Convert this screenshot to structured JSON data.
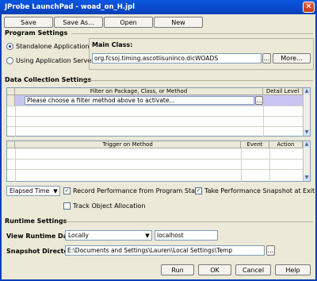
{
  "window": {
    "title": "JProbe LaunchPad - woad_on_H.jpl",
    "close_glyph": "✕"
  },
  "toolbar": {
    "save": "Save",
    "save_as": "Save As...",
    "open": "Open",
    "new": "New"
  },
  "program_settings": {
    "label": "Program Settings",
    "standalone_label": "Standalone Application",
    "server_label": "Using Application Server",
    "main_class_label": "Main Class:",
    "main_class_value": "org.fcsoj.timing.ascotlisuninco.dicWOADS",
    "browse": "...",
    "more": "More..."
  },
  "data_collection": {
    "label": "Data Collection Settings",
    "filter_table": {
      "col_filter": "Filter on Package, Class, or Method",
      "col_detail": "Detail Level",
      "row_value": "Please choose a filter method above to activate..."
    },
    "trigger_table": {
      "col_trigger": "Trigger on Method",
      "col_event": "Event",
      "col_action": "Action"
    },
    "elapsed_combo": "Elapsed Time",
    "record_perf_label": "Record Performance from Program Start",
    "snapshot_label": "Take Performance Snapshot at Exit",
    "track_alloc_label": "Track Object Allocation"
  },
  "runtime": {
    "label": "Runtime Settings",
    "view_label": "View Runtime Data:",
    "view_value": "Locally",
    "host_value": "localhost",
    "snapshot_dir_label": "Snapshot Directory:",
    "snapshot_dir_value": "E:\\Documents and Settings\\Lauren\\Local Settings\\Temp"
  },
  "footer": {
    "run": "Run",
    "ok": "OK",
    "cancel": "Cancel",
    "help": "Help"
  }
}
